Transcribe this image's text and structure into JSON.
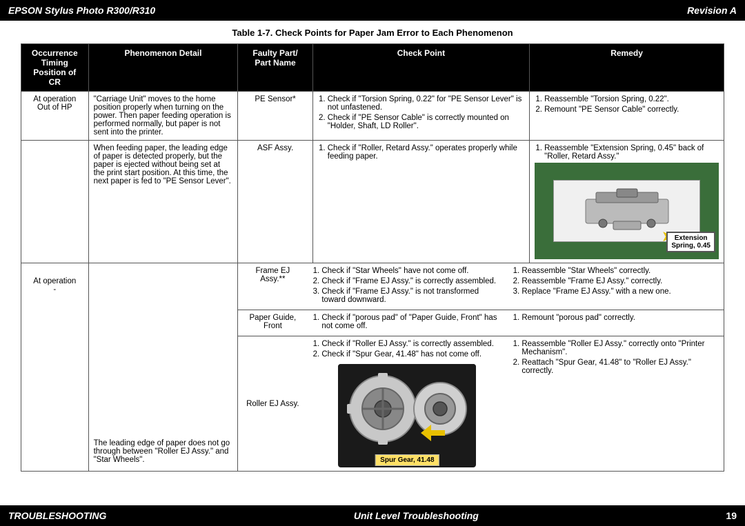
{
  "header": {
    "title": "EPSON Stylus Photo R300/R310",
    "revision": "Revision A"
  },
  "footer": {
    "left": "TROUBLESHOOTING",
    "center": "Unit Level Troubleshooting",
    "right": "19"
  },
  "table": {
    "title": "Table 1-7.  Check Points for Paper Jam Error to Each Phenomenon",
    "headers": {
      "occurrence": [
        "Occurrence",
        "Timing",
        "Position of CR"
      ],
      "phenomenon": "Phenomenon Detail",
      "faulty": [
        "Faulty Part/",
        "Part Name"
      ],
      "checkpoint": "Check Point",
      "remedy": "Remedy"
    },
    "rows": [
      {
        "occurrence": [
          "At operation",
          "Out of HP"
        ],
        "phenomenon": "\"Carriage Unit\" moves to the home position properly when turning on the power. Then paper feeding operation is performed normally, but paper is not sent into the printer.",
        "faulty": "PE Sensor*",
        "checkpoints": [
          "Check if \"Torsion Spring, 0.22\" for \"PE Sensor Lever\" is not unfastened.",
          "Check if \"PE Sensor Cable\" is correctly mounted on \"Holder, Shaft, LD Roller\"."
        ],
        "remedies": [
          "Reassemble \"Torsion Spring, 0.22\".",
          "Remount \"PE Sensor Cable\" correctly."
        ]
      },
      {
        "occurrence": [
          ""
        ],
        "phenomenon": "When feeding paper, the leading edge of paper is detected properly, but the paper is ejected without being set at the print start position. At this time, the next paper is fed to \"PE Sensor Lever\".",
        "faulty": "ASF Assy.",
        "checkpoints": [
          "Check if \"Roller, Retard Assy.\" operates properly while feeding paper."
        ],
        "remedies": [
          "Reassemble \"Extension Spring, 0.45\" back of \"Roller, Retard Assy\"."
        ],
        "has_ext_spring_image": true,
        "ext_spring_label": "Extension\nSpring, 0.45"
      },
      {
        "occurrence": [
          "At operation",
          "-"
        ],
        "phenomenon_sub": [
          {
            "faulty": "Frame EJ Assy.**",
            "checkpoints": [
              "Check if \"Star Wheels\" have not come off.",
              "Check if \"Frame EJ Assy.\" is correctly assembled.",
              "Check if \"Frame EJ Assy.\" is not transformed toward downward."
            ],
            "remedies": [
              "Reassemble \"Star Wheels\" correctly.",
              "Reassemble \"Frame EJ Assy.\" correctly.",
              "Replace \"Frame EJ Assy.\" with a new one."
            ]
          },
          {
            "faulty": "Paper Guide, Front",
            "checkpoints": [
              "Check if \"porous pad\" of \"Paper Guide, Front\" has not come off."
            ],
            "remedies": [
              "Remount \"porous pad\" correctly."
            ]
          },
          {
            "faulty": "Roller EJ Assy.",
            "checkpoints": [
              "Check if \"Roller EJ Assy.\" is correctly assembled.",
              "Check if \"Spur Gear, 41.48\" has not come off."
            ],
            "remedies": [
              "Reassemble \"Roller EJ Assy.\" correctly onto \"Printer Mechanism\".",
              "Reattach \"Spur Gear, 41.48\" to \"Roller EJ Assy.\" correctly."
            ],
            "has_spur_gear_image": true,
            "spur_gear_label": "Spur Gear, 41.48"
          }
        ],
        "phenomenon": "The leading edge of paper does not go through between \"Roller EJ Assy.\" and \"Star Wheels\"."
      }
    ]
  }
}
